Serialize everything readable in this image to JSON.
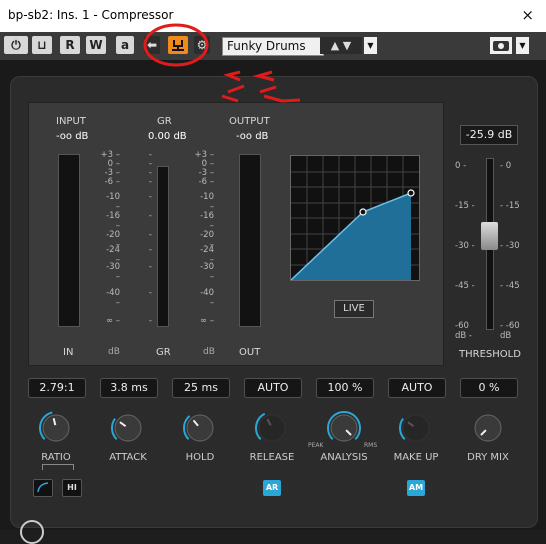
{
  "window": {
    "title": "bp-sb2: Ins. 1 - Compressor",
    "close": "×"
  },
  "toolbar": {
    "power": "⏻",
    "bypass": "⊔",
    "read": "R",
    "write": "W",
    "autofx": "a",
    "sidechain": "⬅",
    "preset": "Funky Drums",
    "arrows": "▲ ▼",
    "dropdown": "▼",
    "camera": "📷",
    "cam_dd": "▼"
  },
  "meters": {
    "input_label": "INPUT",
    "input_value": "-oo dB",
    "gr_label": "GR",
    "gr_value": "0.00 dB",
    "output_label": "OUTPUT",
    "output_value": "-oo dB",
    "scale": [
      "+3",
      "0",
      "-3",
      "-6",
      "-10",
      "-16",
      "-20",
      "-24",
      "-30",
      "-40",
      "∞"
    ],
    "gr_scale": [
      "-",
      "-",
      "-",
      "-",
      "-",
      "-",
      "-",
      "-",
      "-",
      "-",
      "-"
    ],
    "foot_in": "IN",
    "foot_db1": "dB",
    "foot_gr": "GR",
    "foot_db2": "dB",
    "foot_out": "OUT",
    "live": "LIVE"
  },
  "threshold": {
    "value": "-25.9 dB",
    "label": "THRESHOLD",
    "scale": [
      "0",
      "-15",
      "-30",
      "-45",
      "-60\ndB"
    ]
  },
  "controls": [
    {
      "id": "ratio",
      "value": "2.79:1",
      "label": "RATIO",
      "level": 0.45
    },
    {
      "id": "attack",
      "value": "3.8 ms",
      "label": "ATTACK",
      "level": 0.3
    },
    {
      "id": "hold",
      "value": "25 ms",
      "label": "HOLD",
      "level": 0.35
    },
    {
      "id": "release",
      "value": "AUTO",
      "label": "RELEASE",
      "level": 0.4
    },
    {
      "id": "analysis",
      "value": "100 %",
      "label": "ANALYSIS",
      "level": 1.0
    },
    {
      "id": "makeup",
      "value": "AUTO",
      "label": "MAKE UP",
      "level": 0.3
    },
    {
      "id": "drymix",
      "value": "0 %",
      "label": "DRY MIX",
      "level": 0.0
    }
  ],
  "analysis_sub": {
    "peak": "PEAK",
    "rms": "RMS"
  },
  "buttons": {
    "hi": "HI",
    "ar": "AR",
    "am": "AM"
  },
  "colors": {
    "accent": "#2aa7d6",
    "orange": "#f08a1a",
    "annotation": "#e11b1b",
    "curve_fill": "#1f6f99"
  }
}
